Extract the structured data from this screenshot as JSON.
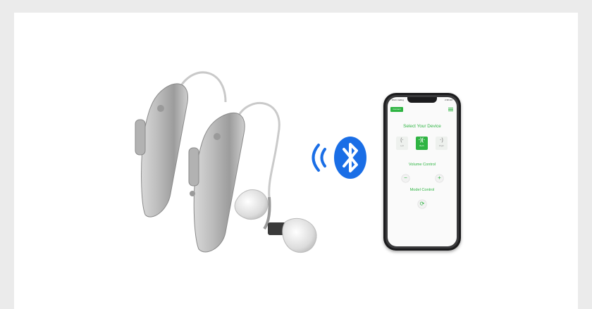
{
  "phone_app": {
    "status_left": "Wi-Fi Calling",
    "status_right": "2:38 AM",
    "connect_label": "Connect",
    "select_title": "Select Your Device",
    "devices": [
      {
        "glyph": "(·",
        "label": "Left"
      },
      {
        "glyph": "·)(·",
        "label": "Both"
      },
      {
        "glyph": "·)",
        "label": "Right"
      }
    ],
    "volume_title": "Volume Control",
    "minus_label": "−",
    "plus_label": "+",
    "model_title": "Model Control",
    "refresh_glyph": "⟳"
  },
  "colors": {
    "accent": "#2fb443",
    "bluetooth": "#1a6ee6",
    "hearing_aid": "#a9a9a9"
  },
  "icons": [
    "bluetooth-icon",
    "wireless-signal-icon",
    "menu-icon",
    "refresh-icon",
    "hearing-aid-image"
  ]
}
